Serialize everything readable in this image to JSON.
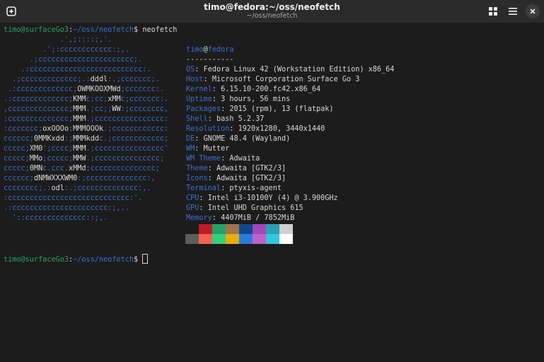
{
  "window": {
    "title": "timo@fedora:~/oss/neofetch",
    "subtitle": "~/oss/neofetch"
  },
  "prompt": {
    "user_host": "timo@surfaceGo3",
    "sep": ":",
    "path": "~/oss/neofetch",
    "symbol": "$",
    "command": "neofetch"
  },
  "logo_lines": [
    "             .',;::::;,'.",
    "         .';:cccccccccccc:;,.",
    "      .;cccccccccccccccccccccc;.",
    "    .:cccccccccccccccccccccccccc:.",
    "  .;ccccccccccccc;.:dddl:.;ccccccc;.",
    " .:ccccccccccccc;OWMKOOXMWd;ccccccc:.",
    ".:ccccccccccccc;KMMc;cc;xMMc;ccccccc:.",
    ",cccccccccccccc;MMM.;cc;;WW:;cccccccc,",
    ":cccccccccccccc;MMM.;cccccccccccccccc:",
    ":ccccccc;oxOOOo;MMMOOOk.;cccccccccccc:",
    "cccccc;0MMKxdd:;MMMkddc.;cccccccccccc;",
    "ccccc;XM0';cccc;MMM.;cccccccccccccccc'",
    "ccccc;MMo;ccccc;MMW.;ccccccccccccccc;",
    "ccccc;0MNc.ccc.xMMd;ccccccccccccccc;",
    "cccccc;dNMWXXXWM0:;cccccccccccccc:,",
    "cccccccc;.:odl:.;cccccccccccccc:,.",
    ":cccccccccccccccccccccccccccc:'.",
    ".:cccccccccccccccccccccc:;,..",
    "  '::cccccccccccccc::;,."
  ],
  "info": {
    "user": "timo",
    "at": "@",
    "host": "fedora",
    "underline": "-----------",
    "rows": [
      {
        "key": "OS",
        "value": "Fedora Linux 42 (Workstation Edition) x86_64"
      },
      {
        "key": "Host",
        "value": "Microsoft Corporation Surface Go 3"
      },
      {
        "key": "Kernel",
        "value": "6.15.10-200.fc42.x86_64"
      },
      {
        "key": "Uptime",
        "value": "3 hours, 56 mins"
      },
      {
        "key": "Packages",
        "value": "2015 (rpm), 13 (flatpak)"
      },
      {
        "key": "Shell",
        "value": "bash 5.2.37"
      },
      {
        "key": "Resolution",
        "value": "1920x1280, 3440x1440"
      },
      {
        "key": "DE",
        "value": "GNOME 48.4 (Wayland)"
      },
      {
        "key": "WM",
        "value": "Mutter"
      },
      {
        "key": "WM Theme",
        "value": "Adwaita"
      },
      {
        "key": "Theme",
        "value": "Adwaita [GTK2/3]"
      },
      {
        "key": "Icons",
        "value": "Adwaita [GTK2/3]"
      },
      {
        "key": "Terminal",
        "value": "ptyxis-agent"
      },
      {
        "key": "CPU",
        "value": "Intel i3-10100Y (4) @ 3.900GHz"
      },
      {
        "key": "GPU",
        "value": "Intel UHD Graphics 615"
      },
      {
        "key": "Memory",
        "value": "4407MiB / 7852MiB"
      }
    ]
  },
  "palette": {
    "row1": [
      "#1c1c1c",
      "#c01c28",
      "#26a269",
      "#a2734c",
      "#12488b",
      "#a347ba",
      "#2aa1b3",
      "#cfcfcf"
    ],
    "row2": [
      "#5d5d5d",
      "#f66151",
      "#33d17a",
      "#e9ad0c",
      "#2a7bde",
      "#c061cb",
      "#33c7de",
      "#ffffff"
    ]
  },
  "icons": {
    "new_tab": "new-tab-icon",
    "overview": "tab-overview-icon",
    "menu": "hamburger-menu-icon",
    "close": "close-icon"
  }
}
